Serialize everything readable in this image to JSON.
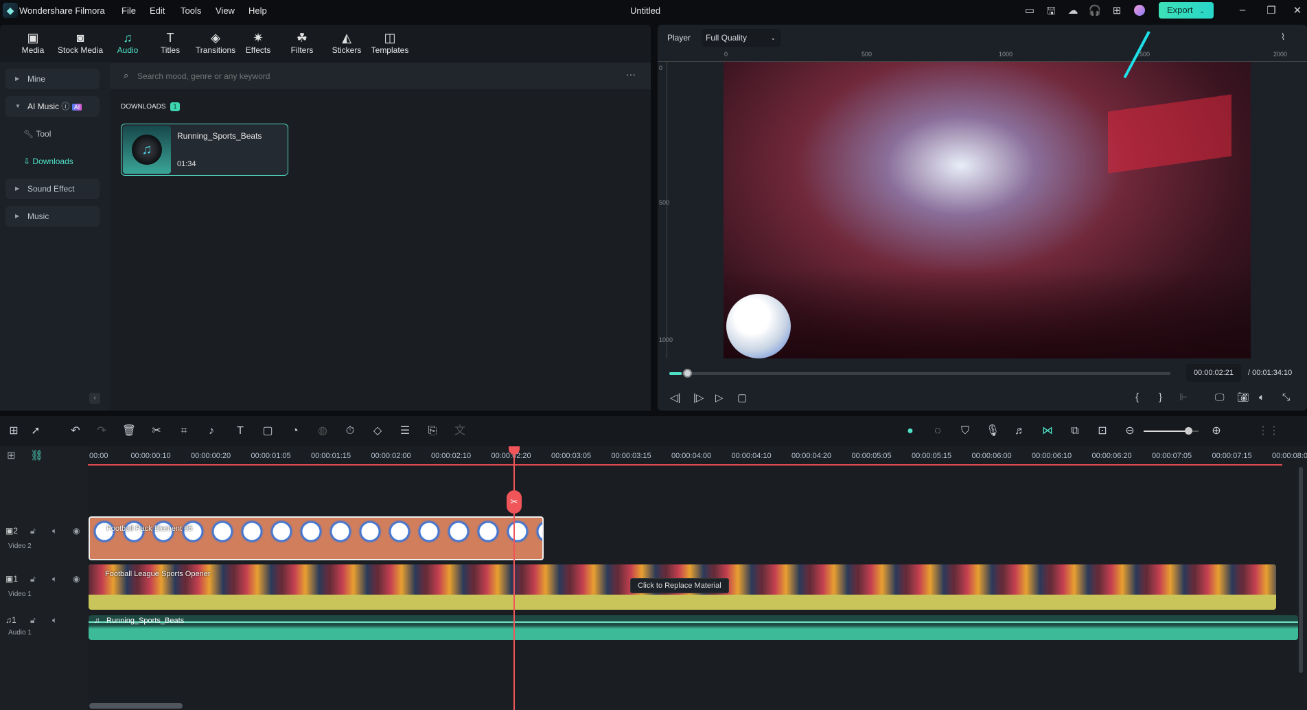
{
  "app": {
    "name": "Wondershare Filmora",
    "title": "Untitled",
    "menu": [
      "File",
      "Edit",
      "Tools",
      "View",
      "Help"
    ],
    "export_label": "Export",
    "accent": "#3de0b8"
  },
  "tabs": [
    {
      "label": "Media",
      "icon": "media-icon"
    },
    {
      "label": "Stock Media",
      "icon": "stock-media-icon"
    },
    {
      "label": "Audio",
      "icon": "music-note-icon",
      "active": true
    },
    {
      "label": "Titles",
      "icon": "titles-icon"
    },
    {
      "label": "Transitions",
      "icon": "transitions-icon"
    },
    {
      "label": "Effects",
      "icon": "effects-icon"
    },
    {
      "label": "Filters",
      "icon": "filters-icon"
    },
    {
      "label": "Stickers",
      "icon": "stickers-icon"
    },
    {
      "label": "Templates",
      "icon": "templates-icon"
    }
  ],
  "sidebar": {
    "mine": "Mine",
    "ai_music": "AI Music",
    "ai_badge": "AI",
    "tool": "Tool",
    "downloads": "Downloads",
    "sound_effect": "Sound Effect",
    "music": "Music"
  },
  "library": {
    "search_placeholder": "Search mood, genre or any keyword",
    "section": "DOWNLOADS",
    "count": "1",
    "items": [
      {
        "title": "Running_Sports_Beats",
        "duration": "01:34"
      }
    ]
  },
  "player": {
    "label": "Player",
    "quality": "Full Quality",
    "ruler_h": [
      "0",
      "500",
      "1000",
      "1500",
      "2000"
    ],
    "ruler_v": [
      "0",
      "500",
      "1000"
    ],
    "current_time": "00:00:02:21",
    "total_time": "/ 00:01:34:10",
    "progress_percent": 2.5
  },
  "timeline": {
    "ticks": [
      "00:00",
      "00:00:00:10",
      "00:00:00:20",
      "00:00:01:05",
      "00:00:01:15",
      "00:00:02:00",
      "00:00:02:10",
      "00:00:02:20",
      "00:00:03:05",
      "00:00:03:15",
      "00:00:04:00",
      "00:00:04:10",
      "00:00:04:20",
      "00:00:05:05",
      "00:00:05:15",
      "00:00:06:00",
      "00:00:06:10",
      "00:00:06:20",
      "00:00:07:05",
      "00:00:07:15",
      "00:00:08:00"
    ],
    "tracks": [
      {
        "num": "2",
        "name": "Video 2",
        "clip": "Football Pack Element 05"
      },
      {
        "num": "1",
        "name": "Video 1",
        "clip": "Football League Sports Opener"
      },
      {
        "num": "1",
        "name": "Audio 1",
        "clip": "Running_Sports_Beats"
      }
    ],
    "tooltip": "Click to Replace Material",
    "zoom_percent": 80
  }
}
